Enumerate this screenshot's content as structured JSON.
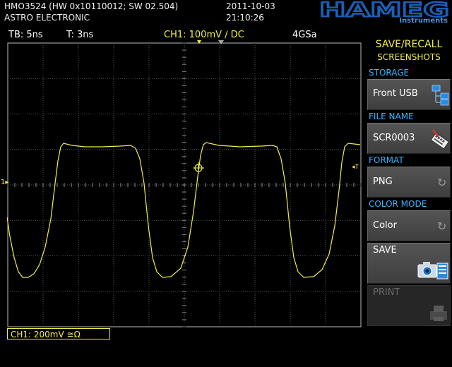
{
  "header": {
    "model_line": "HMO3524 (HW 0x10110012; SW 02.504)",
    "owner": "ASTRO ELECTRONIC",
    "date": "2011-10-03",
    "time": "21:10:26",
    "logo_text": "HAMEG",
    "logo_sub": "Instruments"
  },
  "status": {
    "timebase": "TB: 5ns",
    "trigger_time": "T: 3ns",
    "channel": "CH1: 100mV ∕ DC",
    "sample_rate": "4GSa"
  },
  "channel_box": "CH1: 200mV ≅Ω",
  "markers": {
    "ch1_ground": "1",
    "trigger_level": "T"
  },
  "menu": {
    "title": "SAVE/RECALL",
    "subtitle": "SCREENSHOTS",
    "storage_label": "STORAGE",
    "storage_value": "Front USB",
    "filename_label": "FILE NAME",
    "filename_value": "SCR0003",
    "format_label": "FORMAT",
    "format_value": "PNG",
    "colormode_label": "COLOR MODE",
    "colormode_value": "Color",
    "save_label": "SAVE",
    "print_label": "PRINT"
  },
  "colors": {
    "trace": "#f2ee4a",
    "accent_blue": "#3ab4ff",
    "logo_blue": "#1a5fb4"
  }
}
